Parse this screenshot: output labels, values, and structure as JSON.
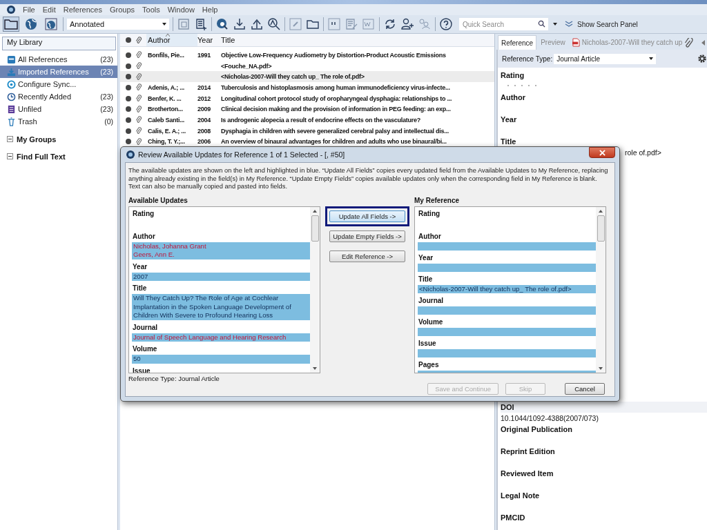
{
  "menu_bar": {
    "items": [
      "File",
      "Edit",
      "References",
      "Groups",
      "Tools",
      "Window",
      "Help"
    ]
  },
  "toolbar": {
    "modes": [
      {
        "kind": "local",
        "selected": true
      },
      {
        "kind": "online",
        "selected": false
      },
      {
        "kind": "integrated",
        "selected": false
      }
    ],
    "style": "Annotated",
    "search": {
      "placeholder": "Quick Search"
    },
    "search_panel_button": "Show Search Panel"
  },
  "sidebar": {
    "header": "My Library",
    "items": [
      {
        "label": "All References",
        "count": "(23)",
        "kind": "all",
        "selected": false
      },
      {
        "label": "Imported References",
        "count": "(23)",
        "kind": "imported",
        "selected": true
      },
      {
        "label": "Configure Sync...",
        "kind": "sync",
        "selected": false
      },
      {
        "label": "Recently Added",
        "count": "(23)",
        "kind": "recent",
        "selected": false
      },
      {
        "label": "Unfiled",
        "count": "(23)",
        "kind": "unfiled",
        "selected": false
      },
      {
        "label": "Trash",
        "count": "(0)",
        "kind": "trash",
        "selected": false
      }
    ],
    "groups": [
      {
        "label": "My Groups",
        "expanded": true
      },
      {
        "label": "Find Full Text",
        "expanded": true
      }
    ]
  },
  "reference_list": {
    "columns": [
      {
        "label": "Author",
        "sorted": true
      },
      {
        "label": "Year",
        "sorted": false
      },
      {
        "label": "Title",
        "sorted": false
      }
    ],
    "rows": [
      {
        "author": "Bonfils, Pie...",
        "year": "1991",
        "title": "Objective Low-Frequency Audiometry by Distortion-Product Acoustic Emissions",
        "selected": false
      },
      {
        "title": "<Fouche_NA.pdf>",
        "selected": false
      },
      {
        "title": "<Nicholas-2007-Will they catch up_ The role of.pdf>",
        "selected": true
      },
      {
        "author": "Adenis, A.; ...",
        "year": "2014",
        "title": "Tuberculosis and histoplasmosis among human immunodeficiency virus-infecte...",
        "selected": false
      },
      {
        "author": "Benfer, K. ...",
        "year": "2012",
        "title": "Longitudinal cohort protocol study of oropharyngeal dysphagia: relationships to ...",
        "selected": false
      },
      {
        "author": "Brotherton...",
        "year": "2009",
        "title": "Clinical decision making and the provision of information in PEG feeding: an exp...",
        "selected": false
      },
      {
        "author": "Caleb Santi...",
        "year": "2004",
        "title": "Is androgenic alopecia a result of endocrine effects on the vasculature?",
        "selected": false
      },
      {
        "author": "Calis, E. A.; ...",
        "year": "2008",
        "title": "Dysphagia in children with severe generalized cerebral palsy and intellectual dis...",
        "selected": false
      },
      {
        "author": "Ching, T. Y.;...",
        "year": "2006",
        "title": "An overview of binaural advantages for children and adults who use binaural/bi...",
        "selected": false
      }
    ]
  },
  "reference_panel": {
    "tabs": [
      {
        "label": "Reference",
        "kind": "text",
        "selected": true
      },
      {
        "label": "Preview",
        "kind": "text",
        "selected": false
      },
      {
        "label": "Nicholas-2007-Will they catch up",
        "kind": "pdf",
        "selected": false
      }
    ],
    "type_label": "Reference Type:",
    "type_value": "Journal Article",
    "fields": [
      {
        "label": "Rating",
        "kind": "rating",
        "stars": 0
      },
      {
        "label": "Author",
        "kind": "text"
      },
      {
        "label": "Year",
        "kind": "text"
      },
      {
        "label": "Title",
        "kind": "covered",
        "value": "role of.pdf>"
      }
    ],
    "lower_fields": [
      {
        "label": "DOI",
        "value": "10.1044/1092-4388(2007/073)"
      },
      {
        "label": "Original Publication"
      },
      {
        "label": "Reprint Edition"
      },
      {
        "label": "Reviewed Item"
      },
      {
        "label": "Legal Note"
      },
      {
        "label": "PMCID"
      }
    ]
  },
  "dialog": {
    "title": "Review Available Updates for Reference 1 of 1 Selected - [, #50]",
    "description": "The available updates are shown on the left and highlighted in blue. “Update All Fields” copies every updated field from the Available Updates to My Reference, replacing anything already existing in the field(s) in My Reference. “Update Empty Fields” copies available updates only when the corresponding field in My Reference is blank. Text can also be manually copied and pasted into fields.",
    "available": {
      "heading": "Available Updates",
      "fields": [
        {
          "label": "Rating",
          "highlighted": false
        },
        {
          "label": "Author",
          "highlighted": true,
          "changed": true,
          "values": [
            "Nicholas, Johanna Grant",
            "Geers, Ann E."
          ]
        },
        {
          "label": "Year",
          "highlighted": true,
          "changed": false,
          "values": [
            "2007"
          ]
        },
        {
          "label": "Title",
          "highlighted": true,
          "changed": false,
          "values": [
            "Will They Catch Up? The Role of Age at Cochlear Implantation in the Spoken Language Development of Children With Severe to Profound Hearing Loss"
          ]
        },
        {
          "label": "Journal",
          "highlighted": true,
          "changed": true,
          "values": [
            "Journal of Speech Language and Hearing Research"
          ]
        },
        {
          "label": "Volume",
          "highlighted": true,
          "changed": false,
          "values": [
            "50"
          ]
        },
        {
          "label": "Issue"
        }
      ]
    },
    "mine": {
      "heading": "My Reference",
      "fields": [
        {
          "label": "Rating",
          "highlighted": false
        },
        {
          "label": "Author",
          "highlighted": true
        },
        {
          "label": "Year",
          "highlighted": true
        },
        {
          "label": "Title",
          "highlighted": true,
          "changed": false,
          "values": [
            "<Nicholas-2007-Will they catch up_ The role of.pdf>"
          ]
        },
        {
          "label": "Journal",
          "highlighted": true
        },
        {
          "label": "Volume",
          "highlighted": true
        },
        {
          "label": "Issue",
          "highlighted": true
        },
        {
          "label": "Pages",
          "highlighted": true
        }
      ]
    },
    "actions": [
      {
        "label": "Update All Fields ->",
        "focused": true
      },
      {
        "label": "Update Empty Fields ->",
        "focused": false
      },
      {
        "label": "Edit Reference ->",
        "focused": false
      }
    ],
    "reference_type": "Reference Type: Journal Article",
    "buttons": [
      {
        "label": "Save and Continue",
        "disabled": true
      },
      {
        "label": "Skip",
        "disabled": true
      },
      {
        "label": "Cancel",
        "disabled": false
      }
    ]
  }
}
